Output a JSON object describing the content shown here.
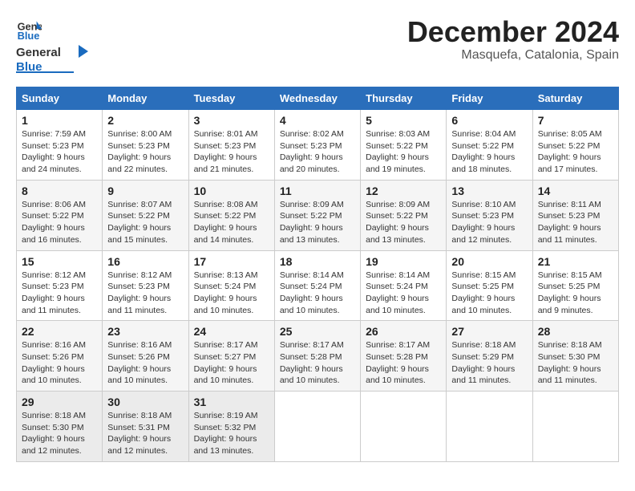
{
  "logo": {
    "line1": "General",
    "line2": "Blue"
  },
  "title": "December 2024",
  "location": "Masquefa, Catalonia, Spain",
  "weekdays": [
    "Sunday",
    "Monday",
    "Tuesday",
    "Wednesday",
    "Thursday",
    "Friday",
    "Saturday"
  ],
  "weeks": [
    [
      {
        "day": "1",
        "sunrise": "7:59 AM",
        "sunset": "5:23 PM",
        "daylight": "9 hours and 24 minutes."
      },
      {
        "day": "2",
        "sunrise": "8:00 AM",
        "sunset": "5:23 PM",
        "daylight": "9 hours and 22 minutes."
      },
      {
        "day": "3",
        "sunrise": "8:01 AM",
        "sunset": "5:23 PM",
        "daylight": "9 hours and 21 minutes."
      },
      {
        "day": "4",
        "sunrise": "8:02 AM",
        "sunset": "5:23 PM",
        "daylight": "9 hours and 20 minutes."
      },
      {
        "day": "5",
        "sunrise": "8:03 AM",
        "sunset": "5:22 PM",
        "daylight": "9 hours and 19 minutes."
      },
      {
        "day": "6",
        "sunrise": "8:04 AM",
        "sunset": "5:22 PM",
        "daylight": "9 hours and 18 minutes."
      },
      {
        "day": "7",
        "sunrise": "8:05 AM",
        "sunset": "5:22 PM",
        "daylight": "9 hours and 17 minutes."
      }
    ],
    [
      {
        "day": "8",
        "sunrise": "8:06 AM",
        "sunset": "5:22 PM",
        "daylight": "9 hours and 16 minutes."
      },
      {
        "day": "9",
        "sunrise": "8:07 AM",
        "sunset": "5:22 PM",
        "daylight": "9 hours and 15 minutes."
      },
      {
        "day": "10",
        "sunrise": "8:08 AM",
        "sunset": "5:22 PM",
        "daylight": "9 hours and 14 minutes."
      },
      {
        "day": "11",
        "sunrise": "8:09 AM",
        "sunset": "5:22 PM",
        "daylight": "9 hours and 13 minutes."
      },
      {
        "day": "12",
        "sunrise": "8:09 AM",
        "sunset": "5:22 PM",
        "daylight": "9 hours and 13 minutes."
      },
      {
        "day": "13",
        "sunrise": "8:10 AM",
        "sunset": "5:23 PM",
        "daylight": "9 hours and 12 minutes."
      },
      {
        "day": "14",
        "sunrise": "8:11 AM",
        "sunset": "5:23 PM",
        "daylight": "9 hours and 11 minutes."
      }
    ],
    [
      {
        "day": "15",
        "sunrise": "8:12 AM",
        "sunset": "5:23 PM",
        "daylight": "9 hours and 11 minutes."
      },
      {
        "day": "16",
        "sunrise": "8:12 AM",
        "sunset": "5:23 PM",
        "daylight": "9 hours and 11 minutes."
      },
      {
        "day": "17",
        "sunrise": "8:13 AM",
        "sunset": "5:24 PM",
        "daylight": "9 hours and 10 minutes."
      },
      {
        "day": "18",
        "sunrise": "8:14 AM",
        "sunset": "5:24 PM",
        "daylight": "9 hours and 10 minutes."
      },
      {
        "day": "19",
        "sunrise": "8:14 AM",
        "sunset": "5:24 PM",
        "daylight": "9 hours and 10 minutes."
      },
      {
        "day": "20",
        "sunrise": "8:15 AM",
        "sunset": "5:25 PM",
        "daylight": "9 hours and 10 minutes."
      },
      {
        "day": "21",
        "sunrise": "8:15 AM",
        "sunset": "5:25 PM",
        "daylight": "9 hours and 9 minutes."
      }
    ],
    [
      {
        "day": "22",
        "sunrise": "8:16 AM",
        "sunset": "5:26 PM",
        "daylight": "9 hours and 10 minutes."
      },
      {
        "day": "23",
        "sunrise": "8:16 AM",
        "sunset": "5:26 PM",
        "daylight": "9 hours and 10 minutes."
      },
      {
        "day": "24",
        "sunrise": "8:17 AM",
        "sunset": "5:27 PM",
        "daylight": "9 hours and 10 minutes."
      },
      {
        "day": "25",
        "sunrise": "8:17 AM",
        "sunset": "5:28 PM",
        "daylight": "9 hours and 10 minutes."
      },
      {
        "day": "26",
        "sunrise": "8:17 AM",
        "sunset": "5:28 PM",
        "daylight": "9 hours and 10 minutes."
      },
      {
        "day": "27",
        "sunrise": "8:18 AM",
        "sunset": "5:29 PM",
        "daylight": "9 hours and 11 minutes."
      },
      {
        "day": "28",
        "sunrise": "8:18 AM",
        "sunset": "5:30 PM",
        "daylight": "9 hours and 11 minutes."
      }
    ],
    [
      {
        "day": "29",
        "sunrise": "8:18 AM",
        "sunset": "5:30 PM",
        "daylight": "9 hours and 12 minutes."
      },
      {
        "day": "30",
        "sunrise": "8:18 AM",
        "sunset": "5:31 PM",
        "daylight": "9 hours and 12 minutes."
      },
      {
        "day": "31",
        "sunrise": "8:19 AM",
        "sunset": "5:32 PM",
        "daylight": "9 hours and 13 minutes."
      },
      null,
      null,
      null,
      null
    ]
  ],
  "labels": {
    "sunrise": "Sunrise:",
    "sunset": "Sunset:",
    "daylight": "Daylight:"
  }
}
